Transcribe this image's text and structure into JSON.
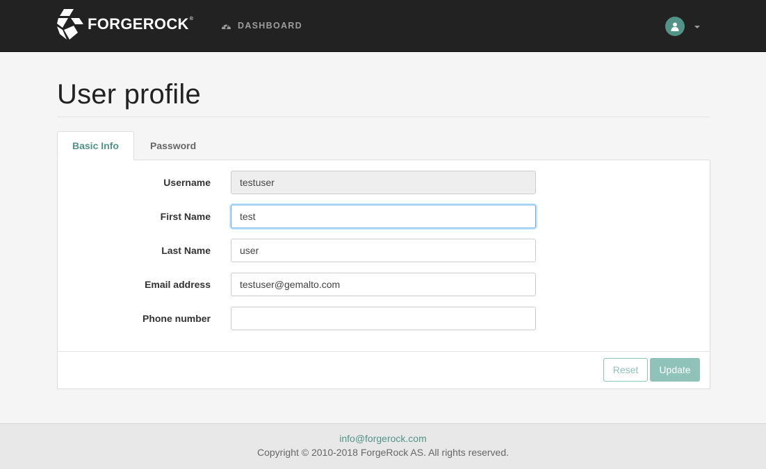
{
  "navbar": {
    "brand": "FORGEROCK",
    "brand_mark": "®",
    "dashboard_label": "DASHBOARD",
    "icons": {
      "dashboard": "dashboard-gauge-icon",
      "user": "user-icon",
      "caret": "caret-down-icon"
    }
  },
  "page": {
    "title": "User profile"
  },
  "tabs": [
    {
      "label": "Basic Info",
      "active": true
    },
    {
      "label": "Password",
      "active": false
    }
  ],
  "form": {
    "fields": [
      {
        "label": "Username",
        "value": "testuser",
        "readonly": true
      },
      {
        "label": "First Name",
        "value": "test",
        "focused": true
      },
      {
        "label": "Last Name",
        "value": "user"
      },
      {
        "label": "Email address",
        "value": "testuser@gemalto.com"
      },
      {
        "label": "Phone number",
        "value": ""
      }
    ],
    "reset_label": "Reset",
    "update_label": "Update"
  },
  "footer": {
    "email": "info@forgerock.com",
    "copyright": "Copyright © 2010-2018 ForgeRock AS. All rights reserved."
  },
  "colors": {
    "navbar_bg": "#222222",
    "accent": "#519387",
    "button_disabled": "#8fc2b8",
    "page_bg": "#f5f5f5"
  }
}
